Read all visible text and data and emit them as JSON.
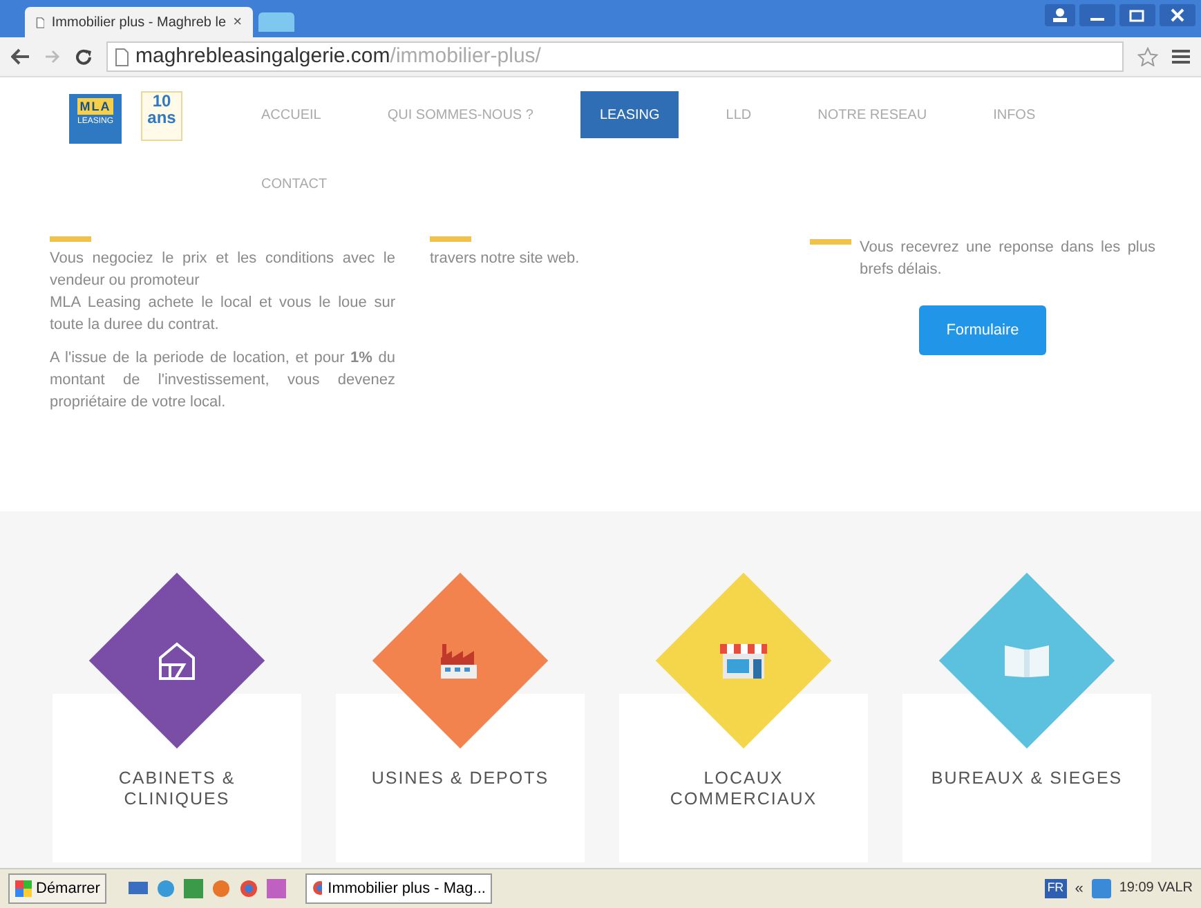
{
  "browser": {
    "tab_title": "Immobilier plus - Maghreb le",
    "tab_close": "×",
    "url_host": "maghrebleasingalgerie.com",
    "url_path": "/immobilier-plus/"
  },
  "logo": {
    "mla": "MLA",
    "leasing": "LEASING",
    "anniversary_number": "10",
    "anniversary_word": "ans"
  },
  "nav": [
    {
      "label": "ACCUEIL",
      "selected": false
    },
    {
      "label": "QUI SOMMES-NOUS ?",
      "selected": false
    },
    {
      "label": "LEASING",
      "selected": true
    },
    {
      "label": "LLD",
      "selected": false
    },
    {
      "label": "NOTRE RESEAU",
      "selected": false
    },
    {
      "label": "INFOS",
      "selected": false
    },
    {
      "label": "CONTACT",
      "selected": false
    }
  ],
  "columns": [
    {
      "paragraphs": [
        {
          "lines": [
            "Vous negociez le prix et les conditions avec le vendeur ou promoteur",
            "MLA Leasing achete le local et vous le loue sur toute la duree du contrat."
          ]
        },
        {
          "lines": [
            "A l'issue de la periode de location, et pour **1%** du montant de l'investissement, vous devenez propriétaire de votre local."
          ]
        }
      ]
    },
    {
      "paragraphs": [
        {
          "lines": [
            "travers notre site web."
          ]
        }
      ]
    },
    {
      "lead": "Vous recevrez une reponse dans les plus brefs délais.",
      "button": "Formulaire"
    }
  ],
  "categories": [
    {
      "kind": "house",
      "color": "#7a4ea6",
      "lines": [
        "CABINETS &",
        "CLINIQUES"
      ]
    },
    {
      "kind": "factory",
      "color": "#f2834f",
      "lines": [
        "USINES & DEPOTS"
      ]
    },
    {
      "kind": "shop",
      "color": "#f5d64a",
      "lines": [
        "LOCAUX",
        "COMMERCIAUX"
      ]
    },
    {
      "kind": "building",
      "color": "#5cc1df",
      "lines": [
        "BUREAUX & SIEGES"
      ]
    }
  ],
  "taskbar": {
    "start": "Démarrer",
    "task": "Immobilier plus - Mag...",
    "lang": "FR",
    "chevron": "«",
    "clock": "19:09 VALR"
  }
}
